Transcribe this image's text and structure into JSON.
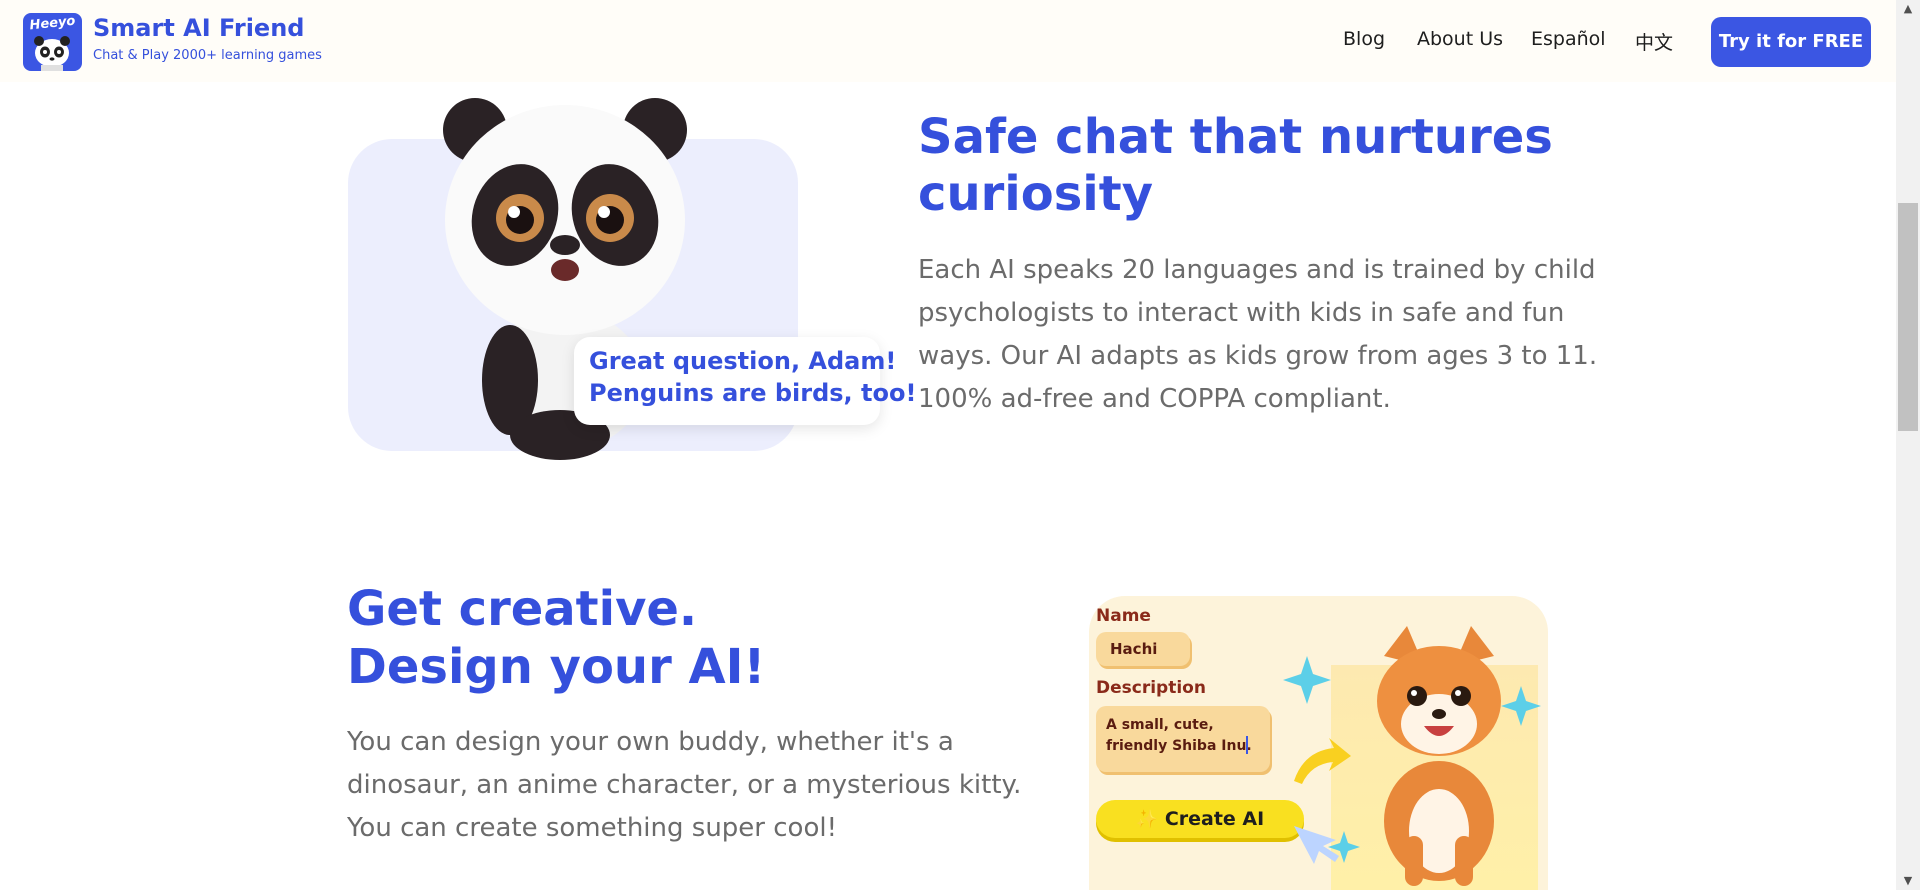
{
  "header": {
    "logo_word": "Heeyo",
    "title": "Smart AI Friend",
    "subtitle": "Chat & Play 2000+ learning games",
    "nav": [
      "Blog",
      "About Us",
      "Español",
      "中文"
    ],
    "cta": "Try it for FREE"
  },
  "section_safe": {
    "bubble_line1": "Great question, Adam!",
    "bubble_line2": "Penguins are birds, too!",
    "heading_line1": "Safe chat that nurtures",
    "heading_line2": "curiosity",
    "para_lines": [
      "Each AI speaks 20 languages and is trained by child",
      "psychologists to interact with kids in safe and fun",
      "ways. Our AI adapts as kids grow from ages 3 to 11.",
      "100% ad-free and COPPA compliant."
    ]
  },
  "section_create": {
    "heading_line1": "Get creative.",
    "heading_line2": "Design your AI!",
    "para_lines": [
      "You can design your own buddy, whether it's a",
      "dinosaur, an anime character, or a mysterious kitty.",
      "You can create something super cool!"
    ],
    "card": {
      "name_label": "Name",
      "name_value": "Hachi",
      "desc_label": "Description",
      "desc_line1": "A small, cute,",
      "desc_line2": "friendly Shiba Inu.",
      "button": "Create AI"
    }
  },
  "colors": {
    "brand_blue": "#3b56e3",
    "body_text": "#6b6b6b",
    "panda_card_bg": "#eceefd",
    "create_card_bg": "#fdf3da"
  }
}
